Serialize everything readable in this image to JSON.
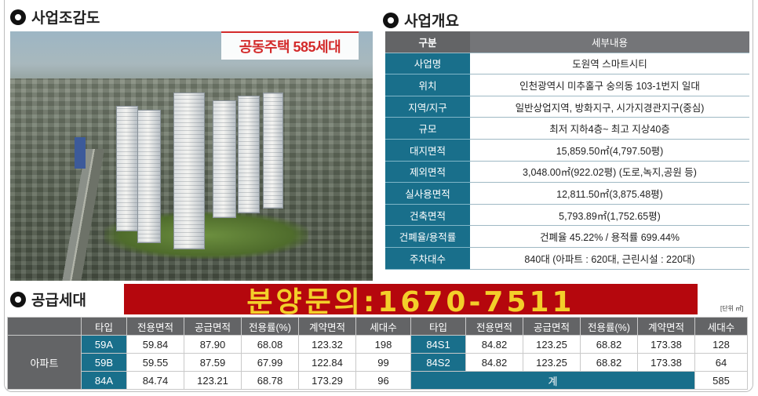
{
  "sections": {
    "site_title": "사업조감도",
    "overview_title": "사업개요",
    "supply_title": "공급세대"
  },
  "site_image": {
    "badge": "공동주택 585세대"
  },
  "overview": {
    "header": {
      "left": "구분",
      "right": "세부내용"
    },
    "rows": [
      {
        "label": "사업명",
        "value": "도원역 스마트시티"
      },
      {
        "label": "위치",
        "value": "인천광역시  미추홀구  숭의동  103-1번지  일대"
      },
      {
        "label": "지역/지구",
        "value": "일반상업지역, 방화지구, 시가지경관지구(중심)"
      },
      {
        "label": "규모",
        "value": "최저 지하4층~ 최고 지상40층"
      },
      {
        "label": "대지면적",
        "value": "15,859.50㎡(4,797.50평)"
      },
      {
        "label": "제외면적",
        "value": "3,048.00㎡(922.02평) (도로,녹지,공원 등)"
      },
      {
        "label": "실사용면적",
        "value": "12,811.50㎡(3,875.48평)"
      },
      {
        "label": "건축면적",
        "value": "5,793.89㎡(1,752.65평)"
      },
      {
        "label": "건폐율/용적률",
        "value": "건폐율 45.22% / 용적률 699.44%"
      },
      {
        "label": "주차대수",
        "value": "840대 (아파트 : 620대, 근린시설 : 220대)"
      }
    ]
  },
  "promo": "분양문의:1670-7511",
  "unit_note": "[단위 ㎡]",
  "supply": {
    "headers": [
      "타입",
      "전용면적",
      "공급면적",
      "전용률(%)",
      "계약면적",
      "세대수",
      "타입",
      "전용면적",
      "공급면적",
      "전용률(%)",
      "계약면적",
      "세대수"
    ],
    "category": "아파트",
    "left_rows": [
      [
        "59A",
        "59.84",
        "87.90",
        "68.08",
        "123.32",
        "198"
      ],
      [
        "59B",
        "59.55",
        "87.59",
        "67.99",
        "122.84",
        "99"
      ],
      [
        "84A",
        "84.74",
        "123.21",
        "68.78",
        "173.29",
        "96"
      ]
    ],
    "right_rows": [
      [
        "84S1",
        "84.82",
        "123.25",
        "68.82",
        "173.38",
        "128"
      ],
      [
        "84S2",
        "84.82",
        "123.25",
        "68.82",
        "173.38",
        "64"
      ]
    ],
    "total_label": "계",
    "total_value": "585"
  },
  "colors": {
    "teal": "#196f8b",
    "gray_header": "#636466",
    "promo_bg": "#b5070d",
    "promo_text": "#f3cf2a",
    "badge_red": "#d32b2b"
  }
}
